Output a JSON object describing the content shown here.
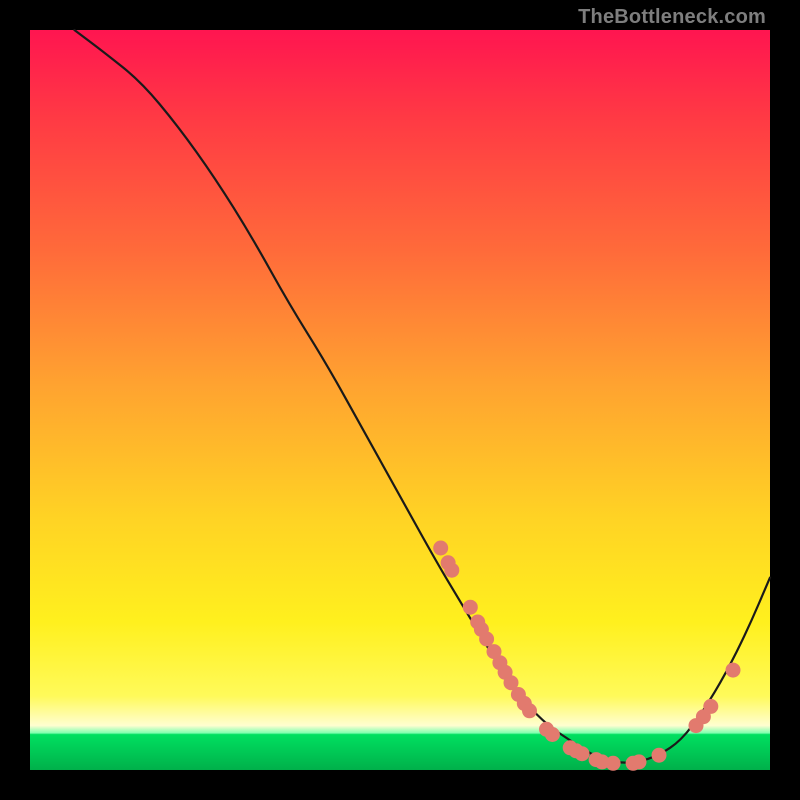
{
  "watermark": "TheBottleneck.com",
  "colors": {
    "dot": "#e27a6e",
    "curve": "#1a1a1a"
  },
  "chart_data": {
    "type": "line",
    "title": "",
    "xlabel": "",
    "ylabel": "",
    "xlim": [
      0,
      100
    ],
    "ylim": [
      0,
      100
    ],
    "grid": false,
    "curve": {
      "x": [
        6,
        10,
        15,
        20,
        25,
        30,
        35,
        40,
        45,
        50,
        55,
        58,
        61,
        64,
        67,
        70,
        73,
        76,
        79,
        82,
        85,
        88,
        91,
        94,
        97,
        100
      ],
      "y": [
        100,
        97,
        93,
        87,
        80,
        72,
        63,
        55,
        46,
        37,
        28,
        23,
        18,
        13,
        9,
        6,
        4,
        2,
        1,
        1,
        2,
        4,
        8,
        13,
        19,
        26
      ]
    },
    "points": [
      {
        "x": 55.5,
        "y": 30.0
      },
      {
        "x": 56.5,
        "y": 28.0
      },
      {
        "x": 57.0,
        "y": 27.0
      },
      {
        "x": 59.5,
        "y": 22.0
      },
      {
        "x": 60.5,
        "y": 20.0
      },
      {
        "x": 61.0,
        "y": 19.0
      },
      {
        "x": 61.7,
        "y": 17.7
      },
      {
        "x": 62.7,
        "y": 16.0
      },
      {
        "x": 63.5,
        "y": 14.5
      },
      {
        "x": 64.2,
        "y": 13.2
      },
      {
        "x": 65.0,
        "y": 11.8
      },
      {
        "x": 66.0,
        "y": 10.2
      },
      {
        "x": 66.8,
        "y": 9.0
      },
      {
        "x": 67.5,
        "y": 8.0
      },
      {
        "x": 69.8,
        "y": 5.5
      },
      {
        "x": 70.6,
        "y": 4.8
      },
      {
        "x": 73.0,
        "y": 3.0
      },
      {
        "x": 73.8,
        "y": 2.6
      },
      {
        "x": 74.6,
        "y": 2.2
      },
      {
        "x": 76.5,
        "y": 1.4
      },
      {
        "x": 77.3,
        "y": 1.1
      },
      {
        "x": 78.8,
        "y": 0.9
      },
      {
        "x": 81.5,
        "y": 0.9
      },
      {
        "x": 82.3,
        "y": 1.1
      },
      {
        "x": 85.0,
        "y": 2.0
      },
      {
        "x": 90.0,
        "y": 6.0
      },
      {
        "x": 91.0,
        "y": 7.2
      },
      {
        "x": 92.0,
        "y": 8.6
      },
      {
        "x": 95.0,
        "y": 13.5
      }
    ]
  }
}
